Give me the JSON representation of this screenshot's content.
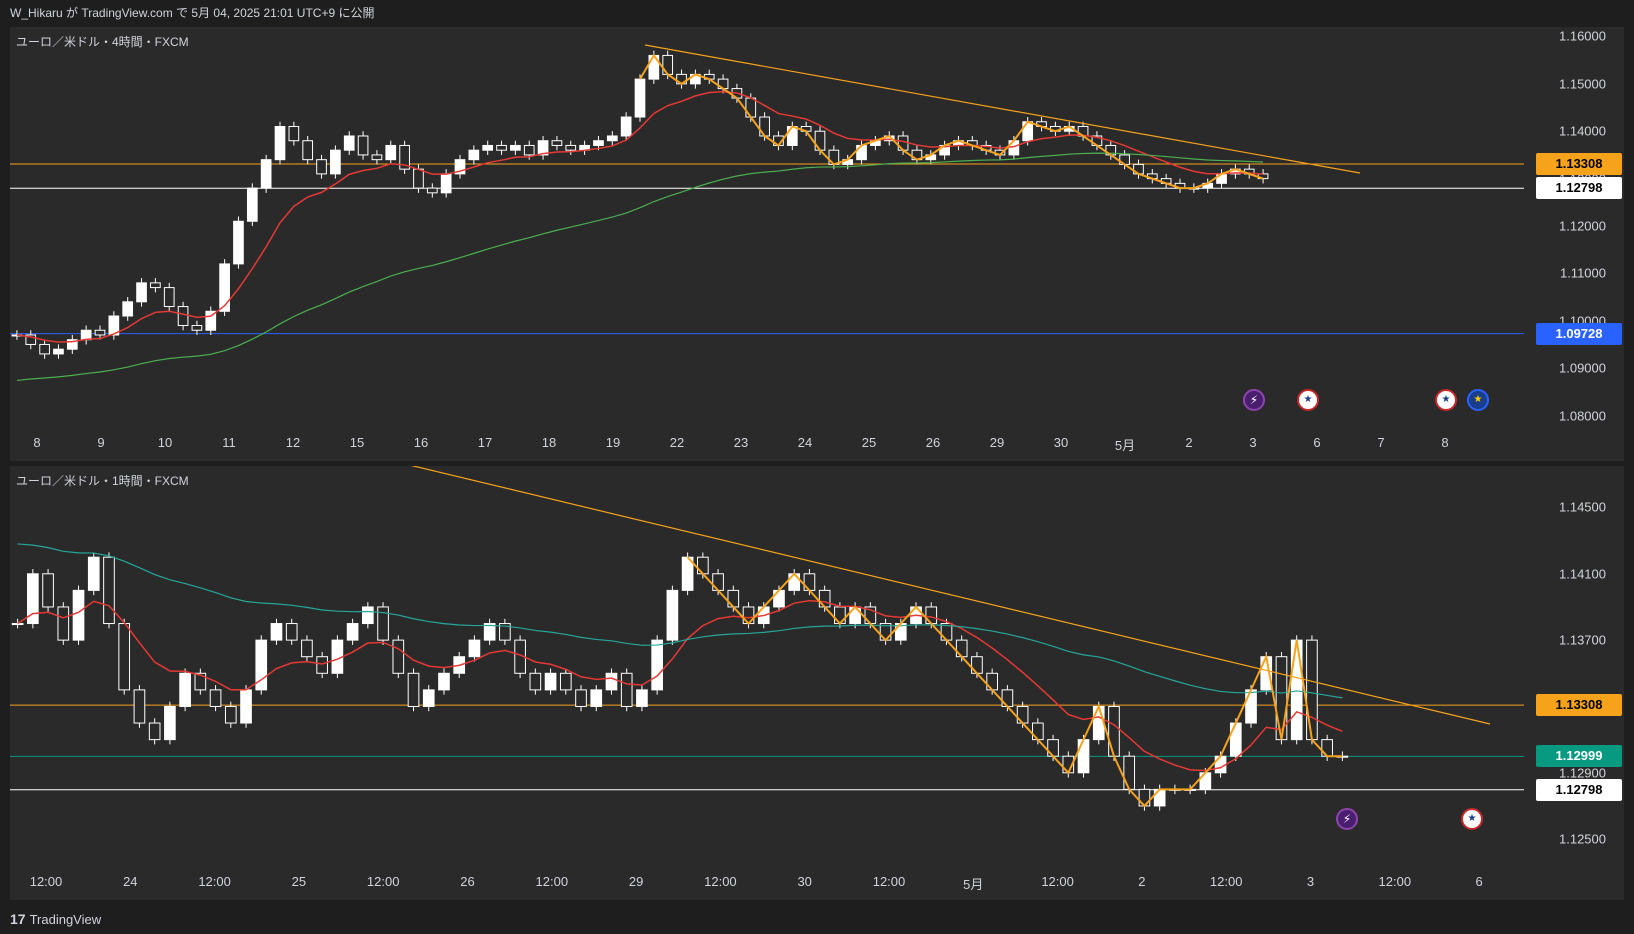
{
  "header": {
    "publish_text": "W_Hikaru が TradingView.com で 5月 04, 2025 21:01 UTC+9 に公開"
  },
  "pane1": {
    "label": "ユーロ／米ドル・4時間・FXCM",
    "price_ticks": [
      "1.16000",
      "1.15000",
      "1.14000",
      "1.13000",
      "1.12000",
      "1.11000",
      "1.10000",
      "1.09000",
      "1.08000"
    ],
    "tags": [
      {
        "text": "1.13308",
        "bg": "#f7a21b",
        "fg": "#000000"
      },
      {
        "text": "1.12798",
        "bg": "#ffffff",
        "fg": "#000000"
      },
      {
        "text": "1.09728",
        "bg": "#2962ff",
        "fg": "#ffffff"
      }
    ],
    "time_labels": [
      "8",
      "9",
      "10",
      "11",
      "12",
      "15",
      "16",
      "17",
      "18",
      "19",
      "22",
      "23",
      "24",
      "25",
      "26",
      "29",
      "30",
      "5月",
      "2",
      "3",
      "6",
      "7",
      "8"
    ]
  },
  "pane2": {
    "label": "ユーロ／米ドル・1時間・FXCM",
    "price_ticks": [
      "1.14500",
      "1.14100",
      "1.13700",
      "1.13300",
      "1.12900",
      "1.12500"
    ],
    "tags": [
      {
        "text": "1.13308",
        "bg": "#f7a21b",
        "fg": "#000000"
      },
      {
        "text": "1.12999",
        "bg": "#089981",
        "fg": "#ffffff"
      },
      {
        "text": "1.12798",
        "bg": "#ffffff",
        "fg": "#000000"
      }
    ],
    "time_labels": [
      "12:00",
      "24",
      "12:00",
      "25",
      "12:00",
      "26",
      "12:00",
      "29",
      "12:00",
      "30",
      "12:00",
      "5月",
      "12:00",
      "2",
      "12:00",
      "3",
      "12:00",
      "6"
    ]
  },
  "events": {
    "bolt_icon": "lightning-bolt-icon",
    "us_icon": "us-flag-icon",
    "eu_icon": "eu-flag-icon"
  },
  "footer": {
    "logo_glyph": "17",
    "brand": "TradingView"
  },
  "colors": {
    "background": "#2a2a2a",
    "up_candle": "#ffffff",
    "down_candle": "#ffffff",
    "ma_red": "#e53935",
    "ma_green": "#4caf50",
    "ma_teal": "#26a69a",
    "trendline": "#f7a21b",
    "wave": "#f7a21b"
  },
  "chart_data": [
    {
      "type": "candlestick",
      "title": "ユーロ／米ドル・4時間・FXCM",
      "ylim": [
        1.078,
        1.162
      ],
      "horizontal_lines": [
        1.13308,
        1.12798,
        1.09728
      ],
      "x_labels": [
        "8",
        "9",
        "10",
        "11",
        "12",
        "15",
        "16",
        "17",
        "18",
        "19",
        "22",
        "23",
        "24",
        "25",
        "26",
        "29",
        "30",
        "5月",
        "2",
        "3",
        "6",
        "7",
        "8"
      ],
      "close_series": [
        1.097,
        1.095,
        1.093,
        1.094,
        1.096,
        1.098,
        1.097,
        1.101,
        1.104,
        1.108,
        1.107,
        1.103,
        1.099,
        1.098,
        1.102,
        1.112,
        1.121,
        1.128,
        1.134,
        1.141,
        1.138,
        1.134,
        1.131,
        1.136,
        1.139,
        1.135,
        1.134,
        1.137,
        1.132,
        1.128,
        1.127,
        1.131,
        1.134,
        1.136,
        1.137,
        1.136,
        1.137,
        1.135,
        1.138,
        1.137,
        1.136,
        1.137,
        1.138,
        1.139,
        1.143,
        1.151,
        1.156,
        1.152,
        1.15,
        1.152,
        1.151,
        1.149,
        1.147,
        1.143,
        1.139,
        1.137,
        1.141,
        1.14,
        1.136,
        1.133,
        1.134,
        1.137,
        1.138,
        1.139,
        1.136,
        1.134,
        1.135,
        1.137,
        1.138,
        1.137,
        1.136,
        1.135,
        1.138,
        1.142,
        1.141,
        1.14,
        1.141,
        1.139,
        1.137,
        1.135,
        1.133,
        1.131,
        1.13,
        1.129,
        1.128,
        1.128,
        1.129,
        1.131,
        1.132,
        1.131,
        1.13
      ]
    },
    {
      "type": "candlestick",
      "title": "ユーロ／米ドル・1時間・FXCM",
      "ylim": [
        1.1235,
        1.1475
      ],
      "horizontal_lines": [
        1.13308,
        1.12999,
        1.12798
      ],
      "x_labels": [
        "12:00",
        "24",
        "12:00",
        "25",
        "12:00",
        "26",
        "12:00",
        "29",
        "12:00",
        "30",
        "12:00",
        "5月",
        "12:00",
        "2",
        "12:00",
        "3",
        "12:00",
        "6"
      ],
      "close_series": [
        1.138,
        1.141,
        1.139,
        1.137,
        1.14,
        1.142,
        1.138,
        1.134,
        1.132,
        1.131,
        1.133,
        1.135,
        1.134,
        1.133,
        1.132,
        1.134,
        1.137,
        1.138,
        1.137,
        1.136,
        1.135,
        1.137,
        1.138,
        1.139,
        1.137,
        1.135,
        1.133,
        1.134,
        1.135,
        1.136,
        1.137,
        1.138,
        1.137,
        1.135,
        1.134,
        1.135,
        1.134,
        1.133,
        1.134,
        1.135,
        1.133,
        1.134,
        1.137,
        1.14,
        1.142,
        1.141,
        1.14,
        1.139,
        1.138,
        1.139,
        1.14,
        1.141,
        1.14,
        1.139,
        1.138,
        1.139,
        1.138,
        1.137,
        1.138,
        1.139,
        1.138,
        1.137,
        1.136,
        1.135,
        1.134,
        1.133,
        1.132,
        1.131,
        1.13,
        1.129,
        1.131,
        1.133,
        1.13,
        1.128,
        1.127,
        1.128,
        1.128,
        1.128,
        1.129,
        1.13,
        1.132,
        1.134,
        1.136,
        1.131,
        1.137,
        1.131,
        1.13,
        1.13
      ]
    }
  ]
}
